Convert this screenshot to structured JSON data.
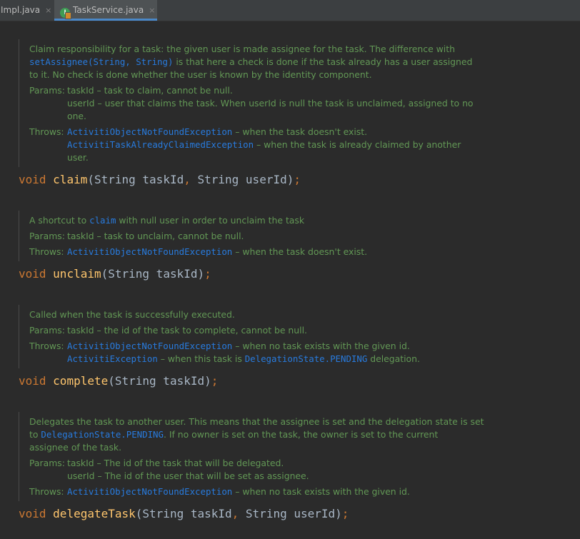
{
  "tabs": [
    {
      "label": "Impl.java",
      "close": "×"
    },
    {
      "label": "TaskService.java",
      "close": "×",
      "icon": "class-interface-icon"
    }
  ],
  "blocks": [
    {
      "doc": {
        "l1": "Claim responsibility for a task: the given user is made assignee for the task. The difference with",
        "l2_code": "setAssignee(String, String)",
        "l2_text": " is that here a check is done if the task already has a user assigned",
        "l3": "to it. No check is done whether the user is known by the identity component.",
        "params_label": "Params:",
        "p1": "taskId – task to claim, cannot be null.",
        "p2a": "userId – user that claims the task. When userId is null the task is unclaimed, assigned to no",
        "p2b": "one.",
        "throws_label": "Throws:",
        "t1_code": "ActivitiObjectNotFoundException",
        "t1_text": " – when the task doesn't exist.",
        "t2_code": "ActivitiTaskAlreadyClaimedException",
        "t2_text": " – when the task is already claimed by another",
        "t2b": "user."
      },
      "sig": {
        "ret": "void",
        "name": "claim",
        "open": "(",
        "p1": "String taskId",
        "comma": ",",
        "p2": " String userId",
        "close": ")",
        "semi": ";"
      }
    },
    {
      "doc": {
        "l1a": "A shortcut to ",
        "l1_code": "claim",
        "l1b": " with null user in order to unclaim the task",
        "params_label": "Params:",
        "p1": "taskId – task to unclaim, cannot be null.",
        "throws_label": "Throws:",
        "t1_code": "ActivitiObjectNotFoundException",
        "t1_text": " – when the task doesn't exist."
      },
      "sig": {
        "ret": "void",
        "name": "unclaim",
        "open": "(",
        "p1": "String taskId",
        "close": ")",
        "semi": ";"
      }
    },
    {
      "doc": {
        "l1": "Called when the task is successfully executed.",
        "params_label": "Params:",
        "p1": "taskId – the id of the task to complete, cannot be null.",
        "throws_label": "Throws:",
        "t1_code": "ActivitiObjectNotFoundException",
        "t1_text": " – when no task exists with the given id.",
        "t2_code": "ActivitiException",
        "t2_text": " – when this task is ",
        "t2_code2": "DelegationState.PENDING",
        "t2_text2": " delegation."
      },
      "sig": {
        "ret": "void",
        "name": "complete",
        "open": "(",
        "p1": "String taskId",
        "close": ")",
        "semi": ";"
      }
    },
    {
      "doc": {
        "l1": "Delegates the task to another user. This means that the assignee is set and the delegation state is set",
        "l2a": "to ",
        "l2_code": "DelegationState.PENDING",
        "l2b": ". If no owner is set on the task, the owner is set to the current",
        "l3": "assignee of the task.",
        "params_label": "Params:",
        "p1": "taskId – The id of the task that will be delegated.",
        "p2": "userId – The id of the user that will be set as assignee.",
        "throws_label": "Throws:",
        "t1_code": "ActivitiObjectNotFoundException",
        "t1_text": " – when no task exists with the given id."
      },
      "sig": {
        "ret": "void",
        "name": "delegateTask",
        "open": "(",
        "p1": "String taskId",
        "comma": ",",
        "p2": " String userId",
        "close": ")",
        "semi": ";"
      }
    }
  ],
  "colors": {
    "background": "#2b2b2b",
    "doc_text": "#629755",
    "doc_code": "#287bde",
    "keyword": "#cc7832",
    "method": "#ffc66d",
    "default": "#a9b7c6"
  }
}
